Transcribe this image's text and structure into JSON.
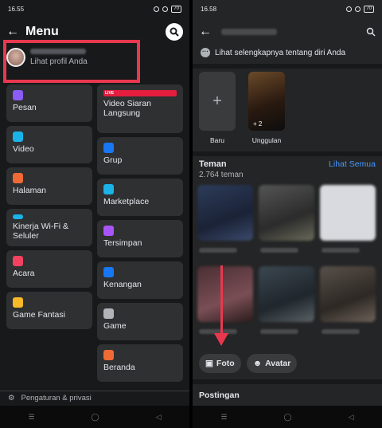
{
  "left": {
    "status": {
      "time": "16.55",
      "battery": "70"
    },
    "header": {
      "title": "Menu"
    },
    "profile": {
      "link": "Lihat profil Anda"
    },
    "menu_left": [
      {
        "label": "Pesan",
        "icon": "messenger-icon",
        "color": "#8b5cf6"
      },
      {
        "label": "Video",
        "icon": "video-icon",
        "color": "#1ab3e8"
      },
      {
        "label": "Halaman",
        "icon": "flag-icon",
        "color": "#f06a35"
      },
      {
        "label": "Kinerja Wi-Fi & Seluler",
        "icon": "wifi-icon",
        "color": "#1ab3e8"
      },
      {
        "label": "Acara",
        "icon": "calendar-icon",
        "color": "#f3425f"
      },
      {
        "label": "Game Fantasi",
        "icon": "trophy-icon",
        "color": "#f7b928"
      }
    ],
    "menu_right": [
      {
        "label": "Video Siaran Langsung",
        "icon": "live-icon",
        "badge": "LIVE",
        "color": "#e41e3f"
      },
      {
        "label": "Grup",
        "icon": "group-icon",
        "color": "#1877f2"
      },
      {
        "label": "Marketplace",
        "icon": "marketplace-icon",
        "color": "#1ab3e8"
      },
      {
        "label": "Tersimpan",
        "icon": "bookmark-icon",
        "color": "#a855f7"
      },
      {
        "label": "Kenangan",
        "icon": "clock-icon",
        "color": "#1877f2"
      },
      {
        "label": "Game",
        "icon": "gamepad-icon",
        "color": "#b0b3b8"
      },
      {
        "label": "Beranda",
        "icon": "feed-icon",
        "color": "#f06a35"
      }
    ],
    "settings": {
      "label": "Pengaturan & privasi"
    }
  },
  "right": {
    "status": {
      "time": "16.58",
      "battery": "70"
    },
    "more": {
      "label": "Lihat selengkapnya tentang diri Anda"
    },
    "stories": {
      "new_label": "Baru",
      "featured_label": "Unggulan",
      "featured_count": "+ 2"
    },
    "friends": {
      "title": "Teman",
      "count": "2.764 teman",
      "see_all": "Lihat Semua"
    },
    "chips": {
      "photo": "Foto",
      "avatar": "Avatar"
    },
    "posts": {
      "title": "Postingan"
    }
  },
  "nav": {
    "menu": "☰",
    "home": "◯",
    "back": "◁"
  }
}
